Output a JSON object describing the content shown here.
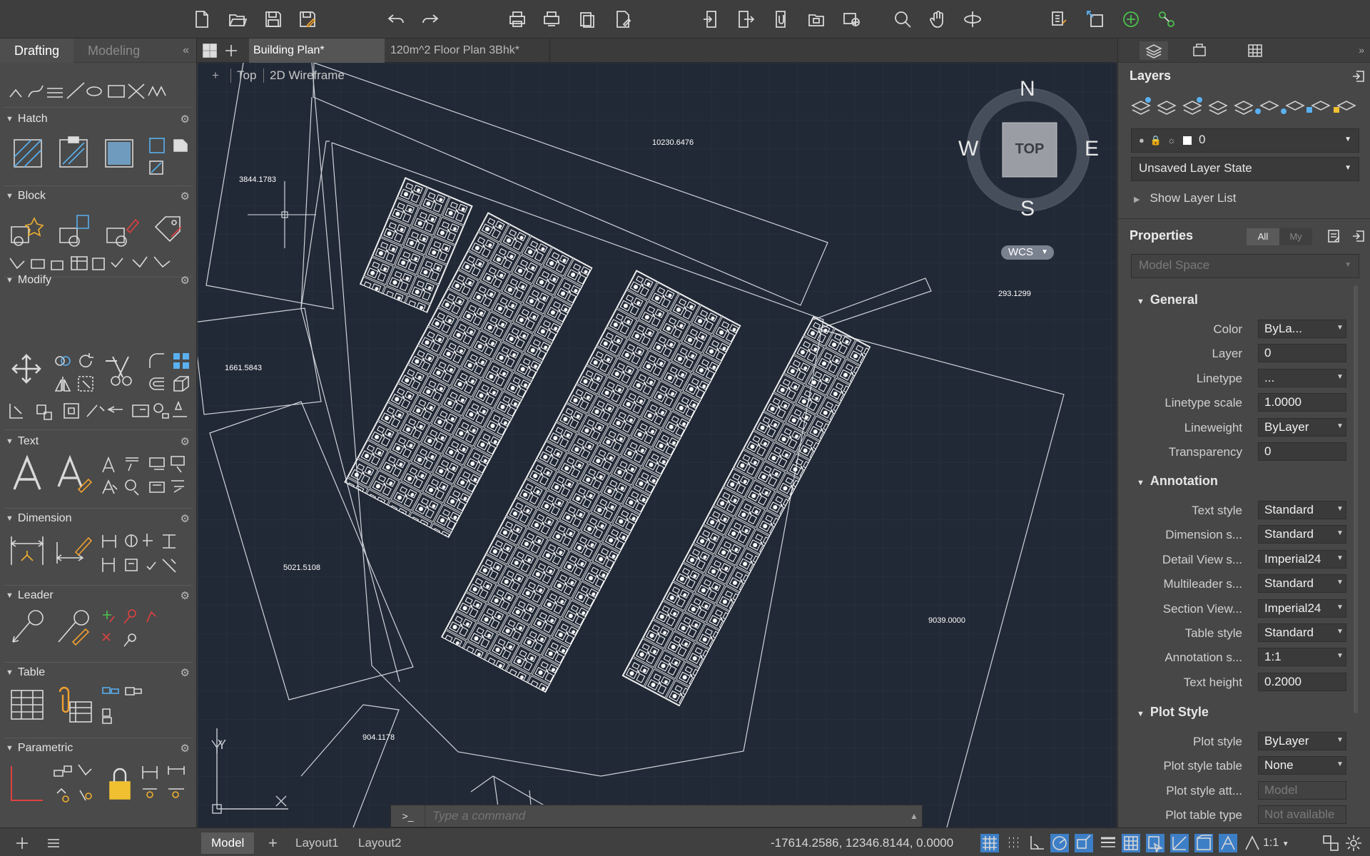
{
  "toolbar": {
    "icons": [
      "new-file",
      "open-file",
      "save",
      "save-as",
      "undo",
      "redo",
      "plot",
      "batch-plot",
      "publish",
      "page-setup",
      "import",
      "export",
      "attach",
      "xref",
      "share",
      "zoom",
      "pan",
      "orbit",
      "layer-props",
      "insert",
      "add-new",
      "connect"
    ]
  },
  "left_panel": {
    "tabs": [
      "Drafting",
      "Modeling"
    ],
    "collapse": "«",
    "sections": [
      "Hatch",
      "Block",
      "Modify",
      "Text",
      "Dimension",
      "Leader",
      "Table",
      "Parametric"
    ],
    "gear": "⚙"
  },
  "file_tabs": {
    "active": "Building Plan*",
    "other": "120m^2 Floor Plan 3Bhk*"
  },
  "viewport": {
    "controls": {
      "plus": "+",
      "view": "Top",
      "style": "2D Wireframe"
    },
    "viewcube": {
      "n": "N",
      "s": "S",
      "e": "E",
      "w": "W",
      "face": "TOP",
      "wcs": "WCS"
    },
    "dimensions": [
      "10230.6476",
      "3844.1783",
      "293.1299",
      "1661.5843",
      "5021.5108",
      "9039.0000",
      "904.1178"
    ],
    "ucs": {
      "x": "X",
      "y": "Y"
    }
  },
  "command": {
    "prompt": ">_",
    "placeholder": "Type a command"
  },
  "right_panel": {
    "layers_title": "Layers",
    "layer_current": "0",
    "layer_state": "Unsaved Layer State",
    "show_layer_list": "Show Layer List",
    "properties_title": "Properties",
    "filter_all": "All",
    "filter_my": "My",
    "space": "Model Space",
    "groups": {
      "general": "General",
      "annotation": "Annotation",
      "plot_style": "Plot Style"
    },
    "general": [
      {
        "label": "Color",
        "value": "ByLa..."
      },
      {
        "label": "Layer",
        "value": "0"
      },
      {
        "label": "Linetype",
        "value": "..."
      },
      {
        "label": "Linetype scale",
        "value": "1.0000"
      },
      {
        "label": "Lineweight",
        "value": "ByLayer"
      },
      {
        "label": "Transparency",
        "value": "0"
      }
    ],
    "annotation": [
      {
        "label": "Text style",
        "value": "Standard"
      },
      {
        "label": "Dimension s...",
        "value": "Standard"
      },
      {
        "label": "Detail View s...",
        "value": "Imperial24"
      },
      {
        "label": "Multileader s...",
        "value": "Standard"
      },
      {
        "label": "Section View...",
        "value": "Imperial24"
      },
      {
        "label": "Table style",
        "value": "Standard"
      },
      {
        "label": "Annotation s...",
        "value": "1:1"
      },
      {
        "label": "Text height",
        "value": "0.2000"
      }
    ],
    "plot_style": [
      {
        "label": "Plot style",
        "value": "ByLayer"
      },
      {
        "label": "Plot style table",
        "value": "None"
      },
      {
        "label": "Plot style att...",
        "value": "Model"
      },
      {
        "label": "Plot table type",
        "value": "Not available"
      }
    ]
  },
  "status": {
    "tabs": [
      "Model",
      "Layout1",
      "Layout2"
    ],
    "add": "+",
    "coords": "-17614.2586, 12346.8144, 0.0000",
    "scale": "1:1"
  },
  "colors": {
    "viewport_bg": "#222936",
    "panel_bg": "#4a4a4a",
    "accent": "#3d7fc7"
  }
}
